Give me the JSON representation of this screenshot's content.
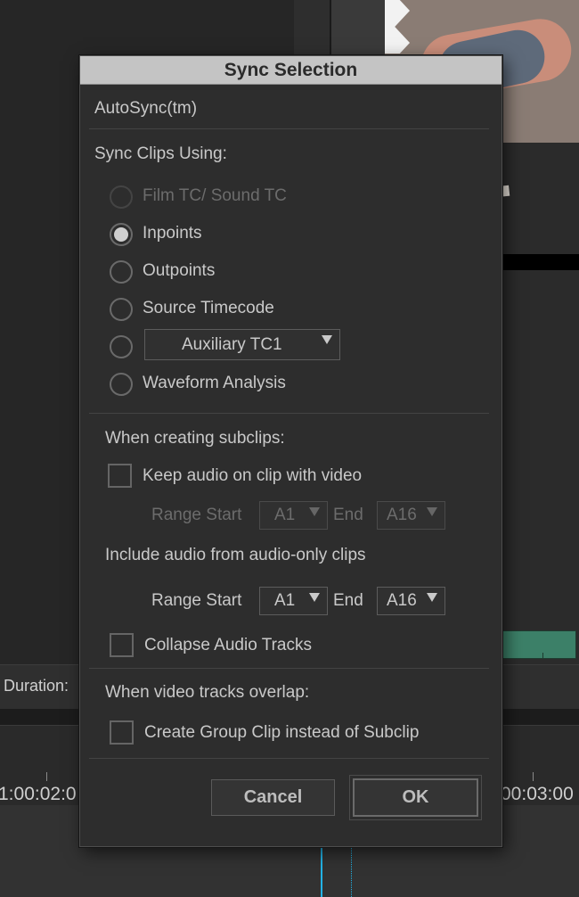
{
  "background": {
    "duration_label": "Duration:",
    "timecode_left": "1:00:02:0",
    "timecode_right": "00:03:00"
  },
  "dialog": {
    "title": "Sync Selection",
    "autosync_label": "AutoSync(tm)",
    "sync_clips_using_label": "Sync Clips Using:",
    "radio_options": {
      "film_tc": {
        "label": "Film TC/ Sound TC",
        "enabled": false,
        "checked": false
      },
      "inpoints": {
        "label": "Inpoints",
        "enabled": true,
        "checked": true
      },
      "outpoints": {
        "label": "Outpoints",
        "enabled": true,
        "checked": false
      },
      "source_timecode": {
        "label": "Source Timecode",
        "enabled": true,
        "checked": false
      },
      "auxiliary": {
        "label": "Auxiliary TC1",
        "enabled": true,
        "checked": false
      },
      "waveform": {
        "label": "Waveform Analysis",
        "enabled": true,
        "checked": false
      }
    },
    "subclips": {
      "heading": "When creating subclips:",
      "keep_audio_label": "Keep audio on clip with video",
      "keep_audio_checked": false,
      "range1": {
        "start_label": "Range Start",
        "start_value": "A1",
        "end_label": "End",
        "end_value": "A16",
        "enabled": false
      },
      "include_audio_label": "Include audio from audio-only clips",
      "range2": {
        "start_label": "Range Start",
        "start_value": "A1",
        "end_label": "End",
        "end_value": "A16",
        "enabled": true
      },
      "collapse_label": "Collapse Audio Tracks",
      "collapse_checked": false
    },
    "overlap": {
      "heading": "When video tracks overlap:",
      "group_clip_label": "Create Group Clip instead of Subclip",
      "group_clip_checked": false
    },
    "buttons": {
      "cancel": "Cancel",
      "ok": "OK"
    }
  }
}
